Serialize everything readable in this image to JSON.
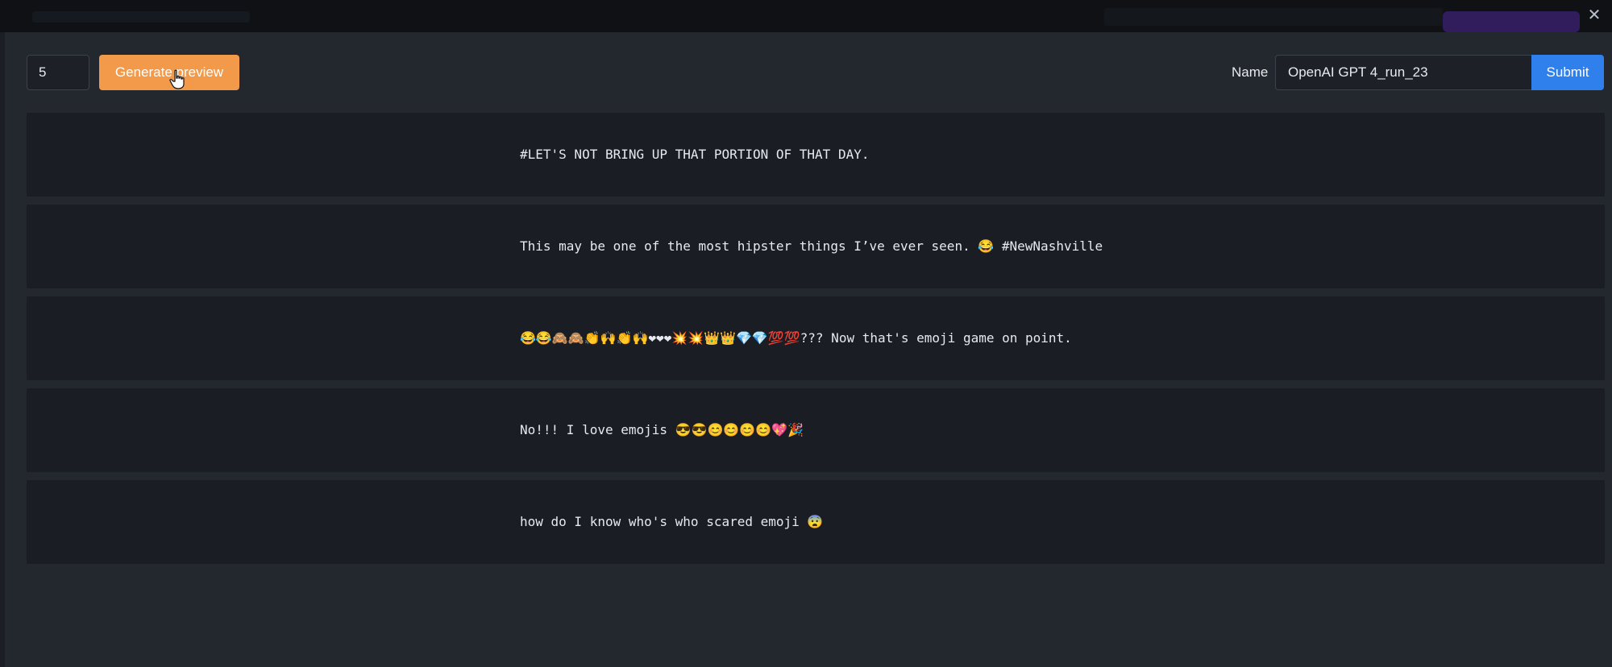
{
  "window": {
    "close_glyph": "✕"
  },
  "toolbar": {
    "count_value": "5",
    "generate_label": "Generate preview",
    "name_label": "Name",
    "name_value": "OpenAI GPT 4_run_23",
    "submit_label": "Submit"
  },
  "colors": {
    "generate_button": "#f2994a",
    "submit_button": "#2f80ed",
    "background": "#23282f",
    "row_background": "#1a1d23"
  },
  "preview": {
    "rows": [
      {
        "text": "#LET'S NOT BRING UP THAT PORTION OF THAT DAY."
      },
      {
        "text": "This may be one of the most hipster things I’ve ever seen. 😂 #NewNashville"
      },
      {
        "text": "😂😂🙈🙈👏🙌👏🙌❤❤❤💥💥👑👑💎💎💯💯??? Now that's emoji game on point."
      },
      {
        "text": "No!!! I love emojis 😎😎😊😊😊😊💖🎉"
      },
      {
        "text": "how do I know who's who scared emoji 😨"
      }
    ]
  },
  "icons": {
    "cursor": "hand-pointer-icon",
    "close": "close-icon"
  }
}
